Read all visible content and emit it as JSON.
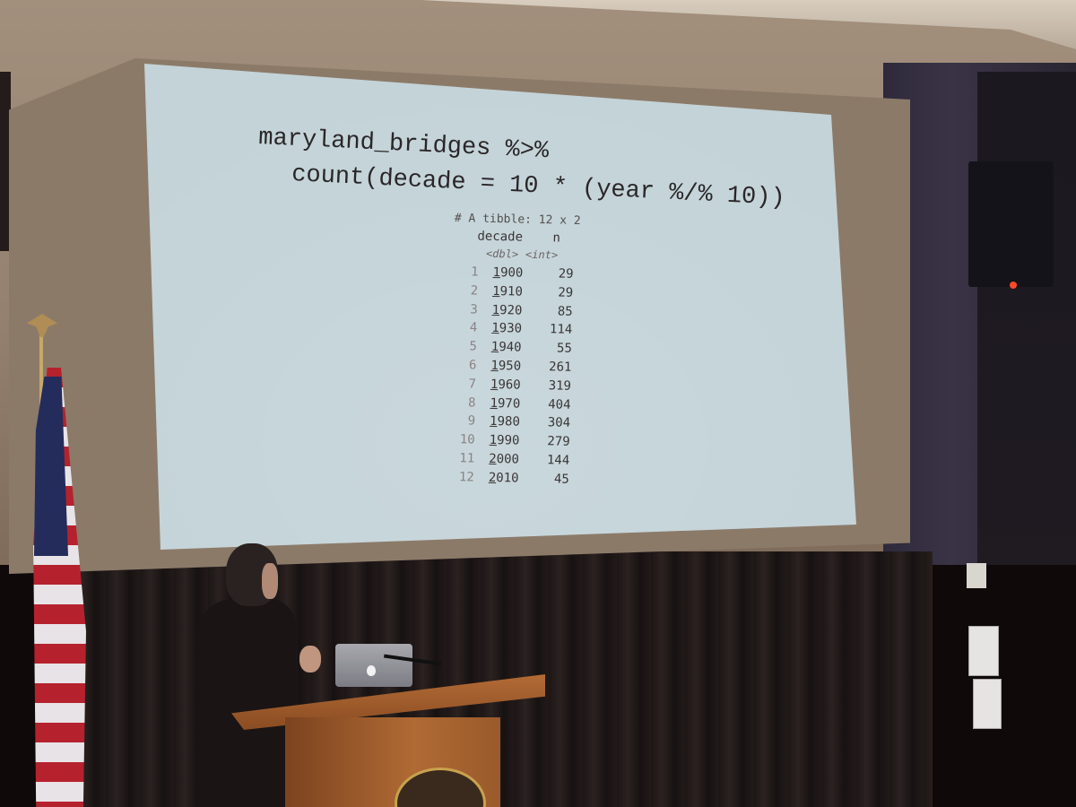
{
  "slide": {
    "code_line1": "maryland_bridges %>%",
    "code_line2": "count(decade = 10 * (year %/% 10))",
    "tibble_header": "# A tibble: 12 x 2",
    "columns": [
      "decade",
      "n"
    ],
    "types": [
      "<dbl>",
      "<int>"
    ],
    "rows": [
      {
        "idx": "1",
        "lead": "1",
        "rest": "900",
        "n": "29"
      },
      {
        "idx": "2",
        "lead": "1",
        "rest": "910",
        "n": "29"
      },
      {
        "idx": "3",
        "lead": "1",
        "rest": "920",
        "n": "85"
      },
      {
        "idx": "4",
        "lead": "1",
        "rest": "930",
        "n": "114"
      },
      {
        "idx": "5",
        "lead": "1",
        "rest": "940",
        "n": "55"
      },
      {
        "idx": "6",
        "lead": "1",
        "rest": "950",
        "n": "261"
      },
      {
        "idx": "7",
        "lead": "1",
        "rest": "960",
        "n": "319"
      },
      {
        "idx": "8",
        "lead": "1",
        "rest": "970",
        "n": "404"
      },
      {
        "idx": "9",
        "lead": "1",
        "rest": "980",
        "n": "304"
      },
      {
        "idx": "10",
        "lead": "1",
        "rest": "990",
        "n": "279"
      },
      {
        "idx": "11",
        "lead": "2",
        "rest": "000",
        "n": "144"
      },
      {
        "idx": "12",
        "lead": "2",
        "rest": "010",
        "n": "45"
      }
    ]
  },
  "colors": {
    "slide_background": "#c3d3d8",
    "code_text": "#2a2628",
    "laptop_logo": "#f2f2f2",
    "speaker_led": "#ff4a2c"
  }
}
